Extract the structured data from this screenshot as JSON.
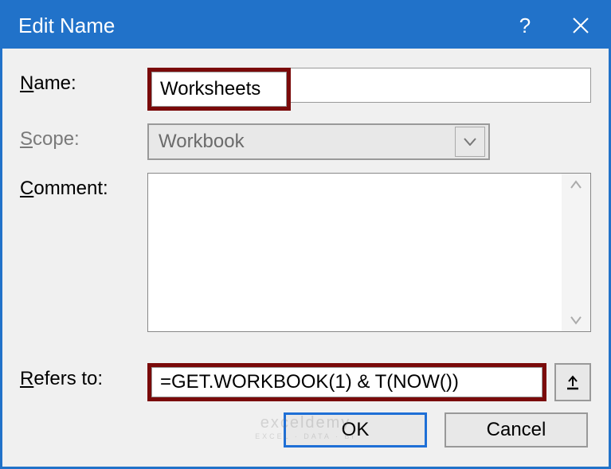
{
  "titlebar": {
    "title": "Edit Name",
    "help": "?",
    "close": "✕"
  },
  "labels": {
    "name": "Name:",
    "scope": "Scope:",
    "comment": "Comment:",
    "refers": "Refers to:"
  },
  "fields": {
    "name_value": "Worksheets",
    "scope_value": "Workbook",
    "comment_value": "",
    "refers_value": "=GET.WORKBOOK(1) & T(NOW())"
  },
  "buttons": {
    "ok": "OK",
    "cancel": "Cancel"
  },
  "watermark": {
    "main": "exceldemy",
    "sub": "EXCEL · DATA · BI"
  }
}
